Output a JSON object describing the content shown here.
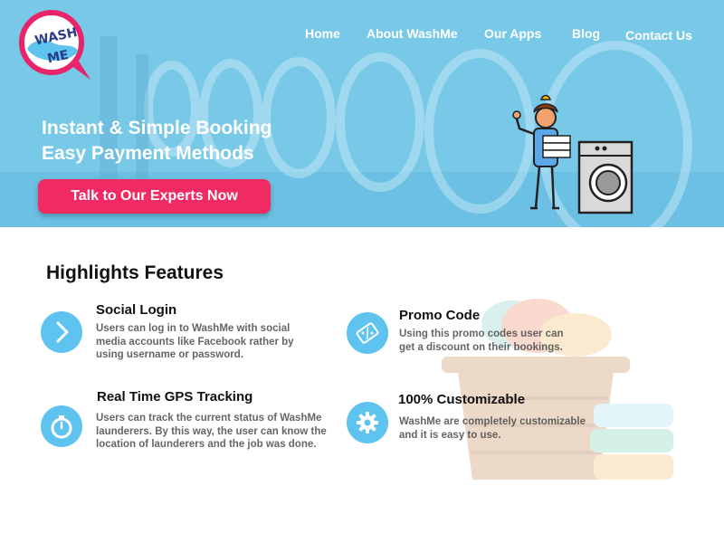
{
  "brand": {
    "logo_text_line1": "WASH",
    "logo_text_line2": "ME"
  },
  "nav": {
    "items": [
      {
        "label": "Home"
      },
      {
        "label": "About WashMe"
      },
      {
        "label": "Our Apps"
      },
      {
        "label": "Blog"
      },
      {
        "label": "Contact Us"
      }
    ]
  },
  "hero": {
    "title_line1": "Instant & Simple Booking",
    "title_line2": "Easy Payment Methods",
    "cta_label": "Talk to Our Experts Now"
  },
  "highlights": {
    "title": "Highlights Features",
    "features": [
      {
        "icon": "chevron-right-icon",
        "title": "Social Login",
        "description": "Users can log in to WashMe with social media accounts like Facebook rather by using username or password."
      },
      {
        "icon": "ticket-icon",
        "title": "Promo Code",
        "description": "Using this promo codes user can get a discount on their bookings."
      },
      {
        "icon": "stopwatch-icon",
        "title": "Real Time GPS Tracking",
        "description": "Users can track the current status of WashMe launderers. By this way, the user can know the location of launderers and the job was done."
      },
      {
        "icon": "gear-icon",
        "title": "100% Customizable",
        "description": "WashMe are completely customizable and it is easy to use."
      }
    ]
  },
  "colors": {
    "accent": "#f02a63",
    "hero_blue": "#6cc3e6",
    "icon_blue": "#5ec4ef"
  }
}
